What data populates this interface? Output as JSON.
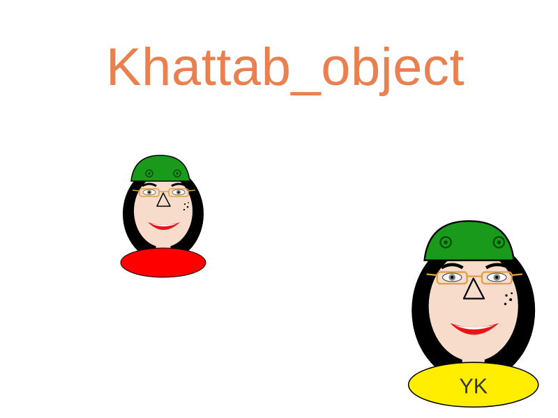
{
  "title": "Khattab_object",
  "figures": [
    {
      "id": "small",
      "badge_color": "#ff0000",
      "badge_label": ""
    },
    {
      "id": "large",
      "badge_color": "#ffee00",
      "badge_label": "YK"
    }
  ],
  "colors": {
    "title": "#E8804F",
    "cap": "#1a9a1a",
    "hair": "#000000",
    "skin": "#f7dccc",
    "lips": "#e8141a",
    "glasses_frame": "#e0a040"
  }
}
